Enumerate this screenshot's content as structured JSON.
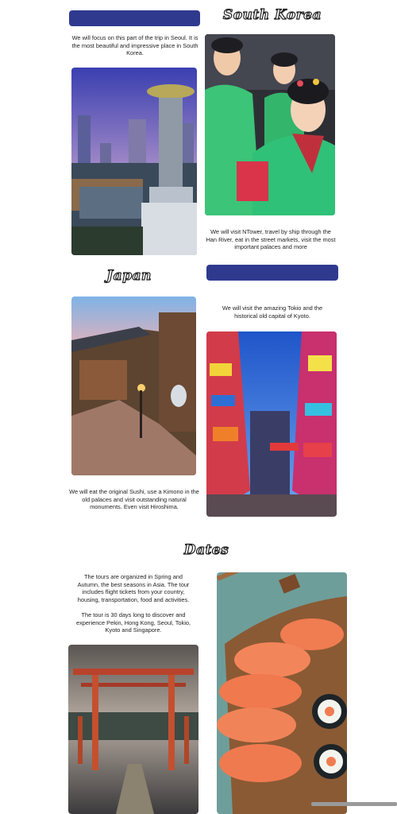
{
  "sections": {
    "korea": {
      "heading": "South Korea",
      "intro": "We will focus on this part of the trip in Seoul. It is the most beautiful and impressive place in South Korea.",
      "details": "We will visit NTower, travel by ship through the Han River, eat in the street markets, visit the most important palaces and more"
    },
    "japan": {
      "heading": "Japan",
      "intro": "We will visit the amazing Tokio and the historical old capital of Kyoto.",
      "details": "We will eat the original Sushi, use a Kimono in the old palaces and visit outstanding natural monuments. Even visit Hiroshima."
    },
    "dates": {
      "heading": "Dates",
      "paragraph_1": "The tours are organized in Spring and Autumn, the best seasons in Asia. The tour includes flight tickets from your country, housing, transportation, food and activities.",
      "paragraph_2": "The tour is 30 days long to discover and experience Pekin, Hong Kong, Seoul, Tokio, Kyoto and Singapore."
    }
  },
  "images": [
    {
      "name": "seoul-buddha-statue-photo",
      "icon": "photo"
    },
    {
      "name": "hanbok-dancers-photo",
      "icon": "photo"
    },
    {
      "name": "kyoto-street-photo",
      "icon": "photo"
    },
    {
      "name": "tokyo-neon-street-photo",
      "icon": "photo"
    },
    {
      "name": "torii-gate-photo",
      "icon": "photo"
    },
    {
      "name": "salmon-sushi-photo",
      "icon": "photo"
    }
  ],
  "colors": {
    "accent_bar": "#2f3a8f",
    "heading_outline": "#222222",
    "background": "#ffffff"
  }
}
